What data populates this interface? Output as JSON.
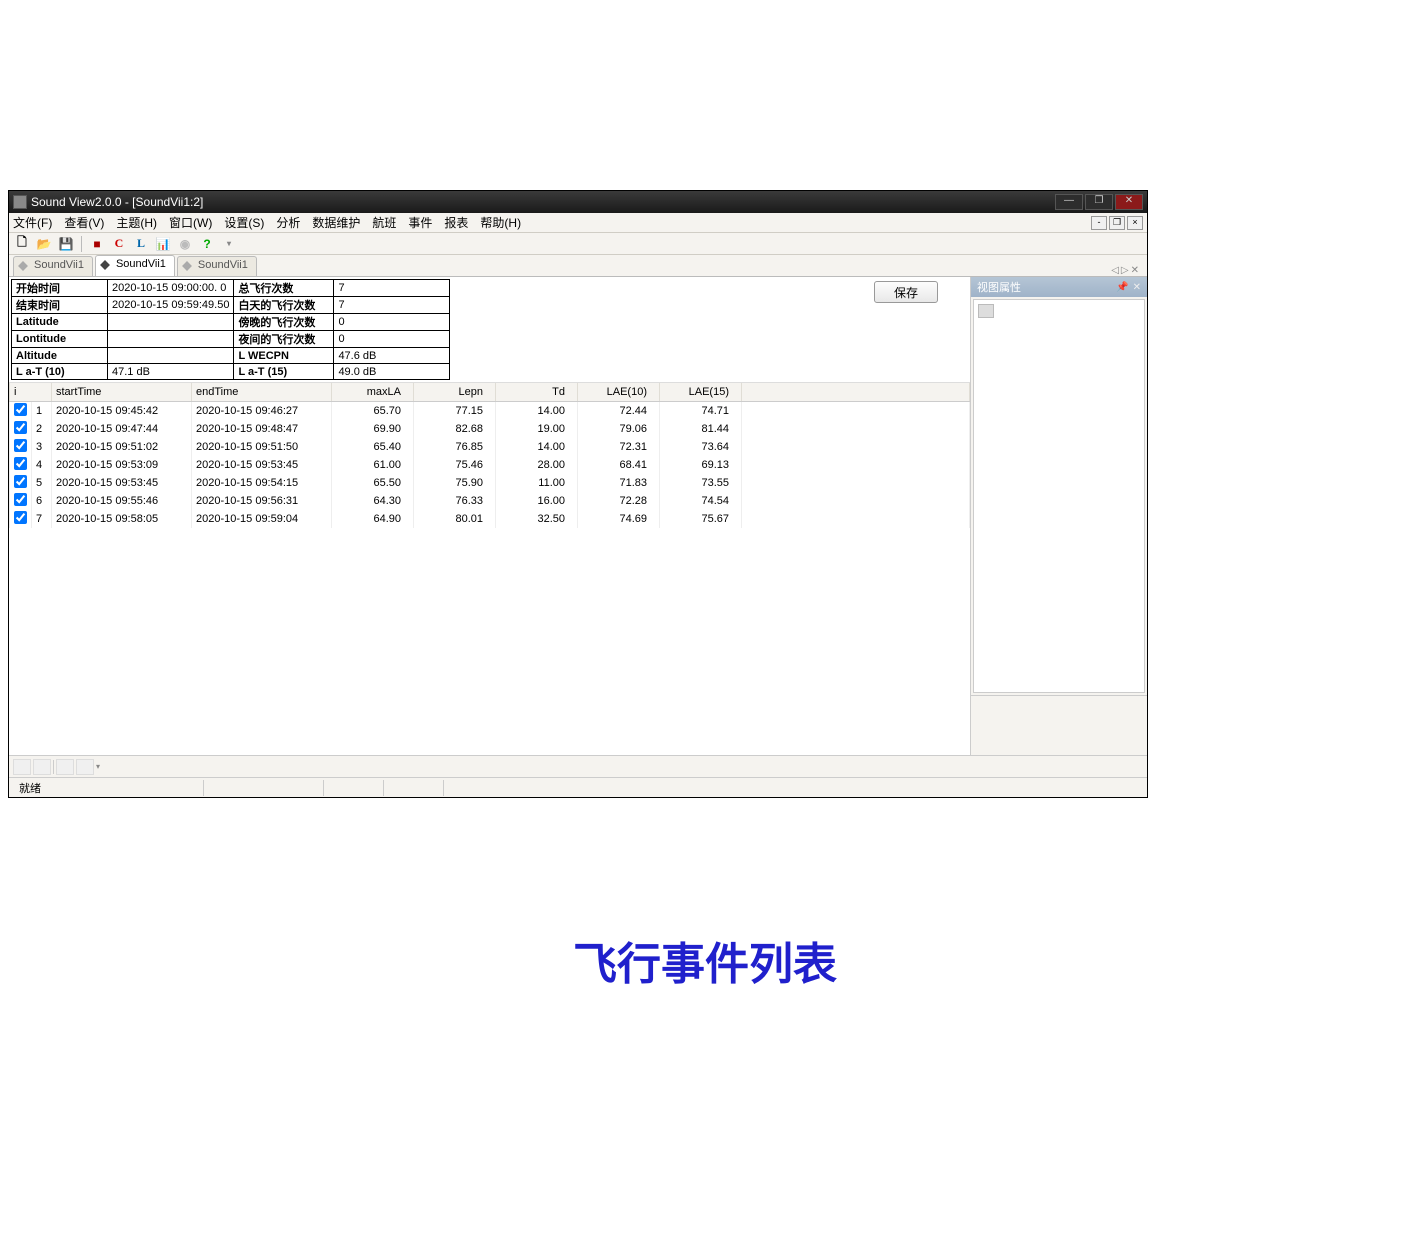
{
  "window": {
    "title": "Sound View2.0.0 - [SoundVii1:2]"
  },
  "menu": [
    "文件(F)",
    "查看(V)",
    "主题(H)",
    "窗口(W)",
    "设置(S)",
    "分析",
    "数据维护",
    "航班",
    "事件",
    "报表",
    "帮助(H)"
  ],
  "tabs": [
    "SoundVii1",
    "SoundVii1",
    "SoundVii1"
  ],
  "save_button": "保存",
  "info": {
    "r1_l": "开始时间",
    "r1_lv": "2020-10-15 09:00:00. 0",
    "r1_r": "总飞行次数",
    "r1_rv": "7",
    "r2_l": "结束时间",
    "r2_lv": "2020-10-15 09:59:49.50",
    "r2_r": "白天的飞行次数",
    "r2_rv": "7",
    "r3_l": "Latitude",
    "r3_lv": "",
    "r3_r": "傍晚的飞行次数",
    "r3_rv": "0",
    "r4_l": "Lontitude",
    "r4_lv": "",
    "r4_r": "夜间的飞行次数",
    "r4_rv": "0",
    "r5_l": "Altitude",
    "r5_lv": "",
    "r5_r": "L WECPN",
    "r5_rv": "47.6 dB",
    "r6_l": "L a-T (10)",
    "r6_lv": "47.1 dB",
    "r6_r": "L a-T (15)",
    "r6_rv": "49.0 dB"
  },
  "columns": [
    "i",
    "startTime",
    "endTime",
    "maxLA",
    "Lepn",
    "Td",
    "LAE(10)",
    "LAE(15)"
  ],
  "rows": [
    {
      "i": "1",
      "startTime": "2020-10-15 09:45:42",
      "endTime": "2020-10-15 09:46:27",
      "maxLA": "65.70",
      "Lepn": "77.15",
      "Td": "14.00",
      "LAE10": "72.44",
      "LAE15": "74.71"
    },
    {
      "i": "2",
      "startTime": "2020-10-15 09:47:44",
      "endTime": "2020-10-15 09:48:47",
      "maxLA": "69.90",
      "Lepn": "82.68",
      "Td": "19.00",
      "LAE10": "79.06",
      "LAE15": "81.44"
    },
    {
      "i": "3",
      "startTime": "2020-10-15 09:51:02",
      "endTime": "2020-10-15 09:51:50",
      "maxLA": "65.40",
      "Lepn": "76.85",
      "Td": "14.00",
      "LAE10": "72.31",
      "LAE15": "73.64"
    },
    {
      "i": "4",
      "startTime": "2020-10-15 09:53:09",
      "endTime": "2020-10-15 09:53:45",
      "maxLA": "61.00",
      "Lepn": "75.46",
      "Td": "28.00",
      "LAE10": "68.41",
      "LAE15": "69.13"
    },
    {
      "i": "5",
      "startTime": "2020-10-15 09:53:45",
      "endTime": "2020-10-15 09:54:15",
      "maxLA": "65.50",
      "Lepn": "75.90",
      "Td": "11.00",
      "LAE10": "71.83",
      "LAE15": "73.55"
    },
    {
      "i": "6",
      "startTime": "2020-10-15 09:55:46",
      "endTime": "2020-10-15 09:56:31",
      "maxLA": "64.30",
      "Lepn": "76.33",
      "Td": "16.00",
      "LAE10": "72.28",
      "LAE15": "74.54"
    },
    {
      "i": "7",
      "startTime": "2020-10-15 09:58:05",
      "endTime": "2020-10-15 09:59:04",
      "maxLA": "64.90",
      "Lepn": "80.01",
      "Td": "32.50",
      "LAE10": "74.69",
      "LAE15": "75.67"
    }
  ],
  "sidepanel": {
    "title": "视图属性"
  },
  "status": "就绪",
  "caption": "飞行事件列表"
}
